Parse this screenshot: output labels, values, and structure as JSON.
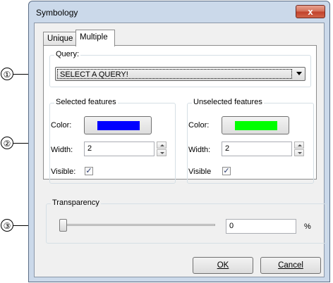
{
  "callouts": [
    "①",
    "②",
    "③"
  ],
  "window": {
    "title": "Symbology",
    "close_glyph": "x"
  },
  "tabs": [
    {
      "label": "Unique"
    },
    {
      "label": "Multiple",
      "active": true
    }
  ],
  "query": {
    "group_label": "Query:",
    "selected": "SELECT A QUERY!"
  },
  "selected_features": {
    "group_label": "Selected features",
    "color_label": "Color:",
    "color": "#0000ff",
    "width_label": "Width:",
    "width": "2",
    "visible_label": "Visible:",
    "visible": true
  },
  "unselected_features": {
    "group_label": "Unselected features",
    "color_label": "Color:",
    "color": "#00ff00",
    "width_label": "Width:",
    "width": "2",
    "visible_label": "Visible",
    "visible": true
  },
  "transparency": {
    "group_label": "Transparency",
    "value": "0",
    "unit": "%",
    "slider_fraction": 0
  },
  "buttons": {
    "ok": "OK",
    "cancel": "Cancel"
  },
  "check_glyph": "✓"
}
